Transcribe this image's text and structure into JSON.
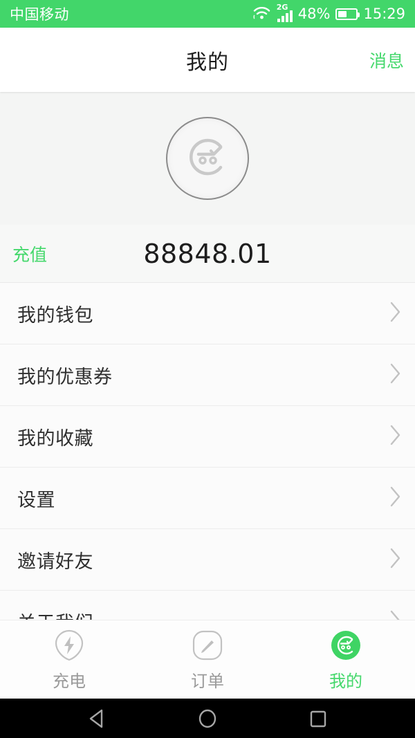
{
  "status_bar": {
    "carrier": "中国移动",
    "network_type": "2G",
    "battery_percent": "48%",
    "battery_level": 48,
    "clock": "15:29",
    "wifi_icon": "wifi-icon",
    "signal_icon": "signal-bars-icon",
    "battery_icon": "battery-icon",
    "background_color": "#42d66a"
  },
  "header": {
    "title": "我的",
    "action_label": "消息"
  },
  "profile": {
    "avatar_icon": "user-avatar-icon"
  },
  "balance": {
    "recharge_label": "充值",
    "amount": "88848.01"
  },
  "menu": {
    "items": [
      {
        "label": "我的钱包",
        "name": "my-wallet"
      },
      {
        "label": "我的优惠券",
        "name": "my-coupons"
      },
      {
        "label": "我的收藏",
        "name": "my-favorites"
      },
      {
        "label": "设置",
        "name": "settings"
      },
      {
        "label": "邀请好友",
        "name": "invite-friends"
      },
      {
        "label": "关于我们",
        "name": "about-us"
      }
    ]
  },
  "tab_bar": {
    "tabs": [
      {
        "label": "充电",
        "icon": "charging-bolt-icon",
        "active": false
      },
      {
        "label": "订单",
        "icon": "order-pencil-icon",
        "active": false
      },
      {
        "label": "我的",
        "icon": "profile-face-icon",
        "active": true
      }
    ],
    "active_color": "#45d86c",
    "inactive_color": "#9a9a9a"
  },
  "nav_bar": {
    "back_icon": "android-back-icon",
    "home_icon": "android-home-icon",
    "recents_icon": "android-recents-icon"
  }
}
